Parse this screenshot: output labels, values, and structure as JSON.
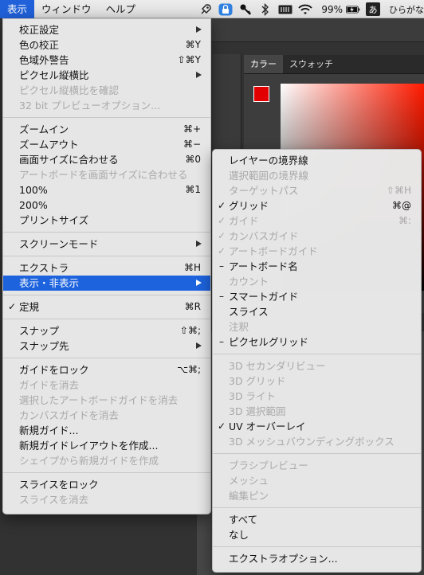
{
  "menubar": {
    "items": [
      {
        "label": "表示"
      },
      {
        "label": "ウィンドウ"
      },
      {
        "label": "ヘルプ"
      }
    ],
    "battery_text": "99%",
    "input_indicator": "あ",
    "input_label": "ひらがな"
  },
  "panel": {
    "tabs": [
      {
        "label": "カラー"
      },
      {
        "label": "スウォッチ"
      }
    ],
    "fg_color": "#e20000",
    "bg_color": "#ffffff"
  },
  "view_menu": {
    "items": [
      {
        "label": "校正設定",
        "arrow": true
      },
      {
        "label": "色の校正",
        "shortcut": "⌘Y"
      },
      {
        "label": "色域外警告",
        "shortcut": "⇧⌘Y"
      },
      {
        "label": "ピクセル縦横比",
        "arrow": true
      },
      {
        "label": "ピクセル縦横比を確認",
        "disabled": true
      },
      {
        "label": "32 bit プレビューオプション...",
        "disabled": true
      },
      {
        "sep": true
      },
      {
        "label": "ズームイン",
        "shortcut": "⌘+"
      },
      {
        "label": "ズームアウト",
        "shortcut": "⌘−"
      },
      {
        "label": "画面サイズに合わせる",
        "shortcut": "⌘0"
      },
      {
        "label": "アートボードを画面サイズに合わせる",
        "disabled": true
      },
      {
        "label": "100%",
        "shortcut": "⌘1"
      },
      {
        "label": "200%"
      },
      {
        "label": "プリントサイズ"
      },
      {
        "sep": true
      },
      {
        "label": "スクリーンモード",
        "arrow": true
      },
      {
        "sep": true
      },
      {
        "label": "エクストラ",
        "shortcut": "⌘H"
      },
      {
        "label": "表示・非表示",
        "arrow": true,
        "highlight": true
      },
      {
        "sep": true
      },
      {
        "label": "定規",
        "shortcut": "⌘R",
        "mark": "✓"
      },
      {
        "sep": true
      },
      {
        "label": "スナップ",
        "shortcut": "⇧⌘;"
      },
      {
        "label": "スナップ先",
        "arrow": true
      },
      {
        "sep": true
      },
      {
        "label": "ガイドをロック",
        "shortcut": "⌥⌘;"
      },
      {
        "label": "ガイドを消去",
        "disabled": true
      },
      {
        "label": "選択したアートボードガイドを消去",
        "disabled": true
      },
      {
        "label": "カンバスガイドを消去",
        "disabled": true
      },
      {
        "label": "新規ガイド..."
      },
      {
        "label": "新規ガイドレイアウトを作成..."
      },
      {
        "label": "シェイプから新規ガイドを作成",
        "disabled": true
      },
      {
        "sep": true
      },
      {
        "label": "スライスをロック"
      },
      {
        "label": "スライスを消去",
        "disabled": true
      }
    ]
  },
  "extras_menu": {
    "items": [
      {
        "label": "レイヤーの境界線"
      },
      {
        "label": "選択範囲の境界線",
        "disabled": true
      },
      {
        "label": "ターゲットパス",
        "shortcut": "⇧⌘H",
        "disabled": true
      },
      {
        "label": "グリッド",
        "shortcut": "⌘@",
        "mark": "✓"
      },
      {
        "label": "ガイド",
        "shortcut": "⌘:",
        "mark": "✓",
        "disabled": true
      },
      {
        "label": "カンバスガイド",
        "mark": "✓",
        "disabled": true
      },
      {
        "label": "アートボードガイド",
        "mark": "✓",
        "disabled": true
      },
      {
        "label": "アートボード名",
        "mark": "–"
      },
      {
        "label": "カウント",
        "disabled": true
      },
      {
        "label": "スマートガイド",
        "mark": "–"
      },
      {
        "label": "スライス"
      },
      {
        "label": "注釈",
        "disabled": true
      },
      {
        "label": "ピクセルグリッド",
        "mark": "–"
      },
      {
        "sep": true
      },
      {
        "label": "3D セカンダリビュー",
        "disabled": true
      },
      {
        "label": "3D グリッド",
        "disabled": true
      },
      {
        "label": "3D ライト",
        "disabled": true
      },
      {
        "label": "3D 選択範囲",
        "disabled": true
      },
      {
        "label": "UV オーバーレイ",
        "mark": "✓"
      },
      {
        "label": "3D メッシュバウンディングボックス",
        "disabled": true
      },
      {
        "sep": true
      },
      {
        "label": "ブラシプレビュー",
        "disabled": true
      },
      {
        "label": "メッシュ",
        "disabled": true
      },
      {
        "label": "編集ピン",
        "disabled": true
      },
      {
        "sep": true
      },
      {
        "label": "すべて"
      },
      {
        "label": "なし"
      },
      {
        "sep": true
      },
      {
        "label": "エクストラオプション..."
      }
    ]
  }
}
